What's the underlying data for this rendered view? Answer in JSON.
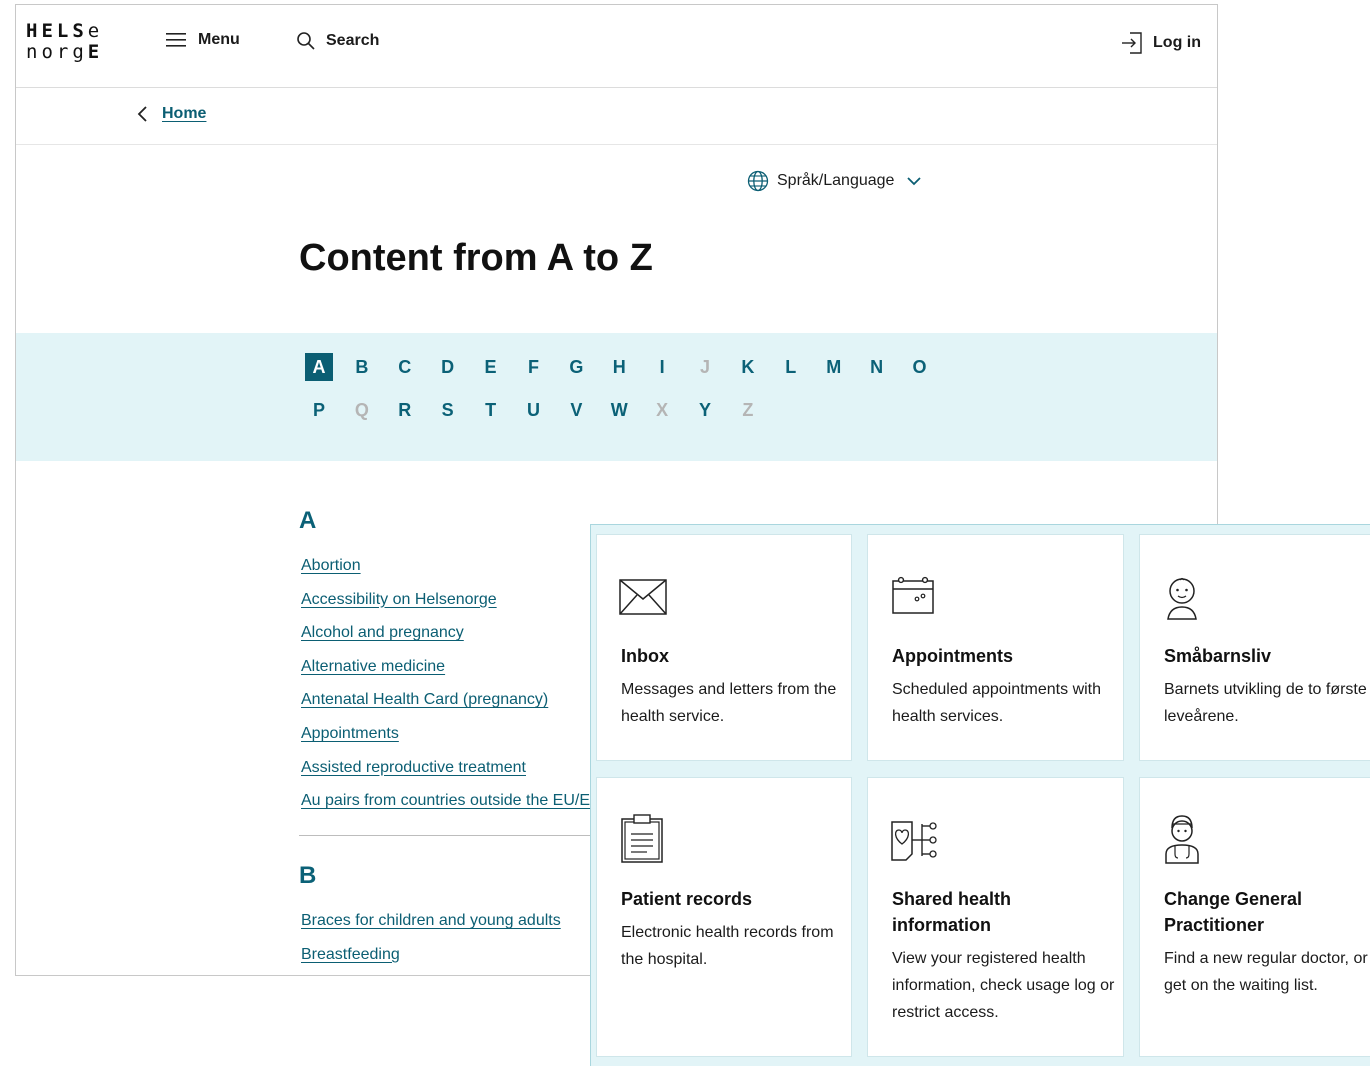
{
  "header": {
    "logo_line1": "HELSe",
    "logo_line2": "norgE",
    "menu_label": "Menu",
    "search_label": "Search",
    "login_label": "Log in"
  },
  "breadcrumb": {
    "home_label": "Home"
  },
  "language": {
    "label": "Språk/Language"
  },
  "page_title": "Content from A to Z",
  "alphabet": [
    {
      "l": "A",
      "state": "active"
    },
    {
      "l": "B",
      "state": "enabled"
    },
    {
      "l": "C",
      "state": "enabled"
    },
    {
      "l": "D",
      "state": "enabled"
    },
    {
      "l": "E",
      "state": "enabled"
    },
    {
      "l": "F",
      "state": "enabled"
    },
    {
      "l": "G",
      "state": "enabled"
    },
    {
      "l": "H",
      "state": "enabled"
    },
    {
      "l": "I",
      "state": "enabled"
    },
    {
      "l": "J",
      "state": "disabled"
    },
    {
      "l": "K",
      "state": "enabled"
    },
    {
      "l": "L",
      "state": "enabled"
    },
    {
      "l": "M",
      "state": "enabled"
    },
    {
      "l": "N",
      "state": "enabled"
    },
    {
      "l": "O",
      "state": "enabled"
    },
    {
      "l": "P",
      "state": "enabled"
    },
    {
      "l": "Q",
      "state": "disabled"
    },
    {
      "l": "R",
      "state": "enabled"
    },
    {
      "l": "S",
      "state": "enabled"
    },
    {
      "l": "T",
      "state": "enabled"
    },
    {
      "l": "U",
      "state": "enabled"
    },
    {
      "l": "V",
      "state": "enabled"
    },
    {
      "l": "W",
      "state": "enabled"
    },
    {
      "l": "X",
      "state": "disabled"
    },
    {
      "l": "Y",
      "state": "enabled"
    },
    {
      "l": "Z",
      "state": "disabled"
    }
  ],
  "sections": {
    "a": {
      "heading": "A",
      "links": [
        "Abortion",
        "Accessibility on Helsenorge",
        "Alcohol and pregnancy",
        "Alternative medicine",
        "Antenatal Health Card (pregnancy)",
        "Appointments",
        "Assisted reproductive treatment",
        "Au pairs from countries outside the EU/EEA"
      ]
    },
    "b": {
      "heading": "B",
      "links": [
        "Braces for children and young adults",
        "Breastfeeding"
      ]
    }
  },
  "cards": {
    "inbox": {
      "title": "Inbox",
      "desc": "Messages and letters from the health service.",
      "icon": "envelope-icon"
    },
    "appointments": {
      "title": "Appointments",
      "desc": "Scheduled appointments with health services.",
      "icon": "calendar-icon"
    },
    "smabarnsliv": {
      "title": "Småbarnsliv",
      "desc": "Barnets utvikling de to første leveårene.",
      "icon": "baby-icon"
    },
    "patient_records": {
      "title": "Patient records",
      "desc": "Electronic health records from the hospital.",
      "icon": "clipboard-icon"
    },
    "shared_health": {
      "title": "Shared health information",
      "desc": "View your registered health information, check usage log or restrict access.",
      "icon": "shared-heart-icon"
    },
    "change_gp": {
      "title": "Change General Practitioner",
      "desc": "Find a new regular doctor, or get on the waiting list.",
      "icon": "doctor-icon"
    }
  },
  "colors": {
    "brand_teal": "#0b5e73",
    "alpha_bg": "#e2f4f7",
    "disabled_letter": "#b5b5b5"
  }
}
